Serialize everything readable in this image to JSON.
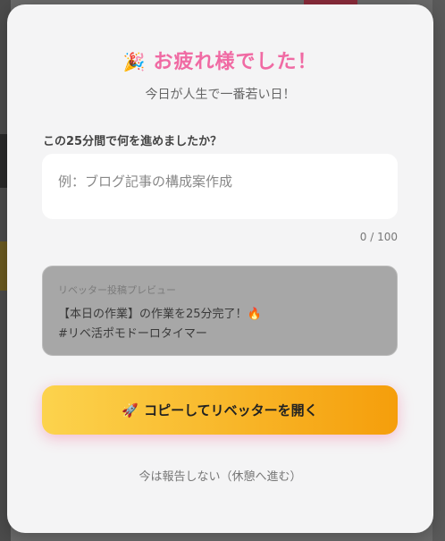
{
  "modal": {
    "title_icon": "🎉",
    "title": "お疲れ様でした！",
    "subtitle": "今日が人生で一番若い日！",
    "question": "この25分間で何を進めましたか？",
    "input": {
      "value": "",
      "placeholder": "例：ブログ記事の構成案作成",
      "counter": "0 / 100"
    },
    "preview": {
      "label": "リベッター投稿プレビュー",
      "line1": "【本日の作業】の作業を25分完了！",
      "line1_icon": "🔥",
      "line2": "#リベ活ポモドーロタイマー"
    },
    "cta": {
      "icon": "🚀",
      "label": "コピーしてリベッターを開く"
    },
    "skip_label": "今は報告しない（休憩へ進む）"
  },
  "colors": {
    "title": "#f06aa3",
    "cta_start": "#fcd34d",
    "cta_end": "#f59e0b",
    "modal_bg": "#f4f4f5",
    "preview_bg": "#a7a7a7"
  }
}
